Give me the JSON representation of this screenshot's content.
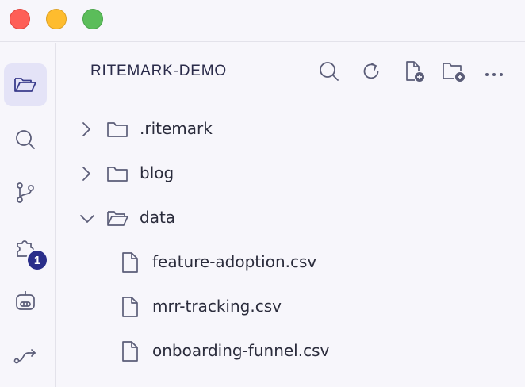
{
  "window": {
    "traffic_lights": [
      "close",
      "minimize",
      "maximize"
    ]
  },
  "activity_bar": {
    "items": [
      {
        "name": "explorer",
        "icon": "folder-open-icon",
        "active": true
      },
      {
        "name": "search",
        "icon": "search-icon",
        "active": false
      },
      {
        "name": "source-control",
        "icon": "source-control-icon",
        "active": false
      },
      {
        "name": "extensions",
        "icon": "puzzle-icon",
        "active": false,
        "badge": "1"
      },
      {
        "name": "assistant",
        "icon": "robot-icon",
        "active": false
      },
      {
        "name": "flows",
        "icon": "route-icon",
        "active": false
      }
    ]
  },
  "explorer": {
    "title": "RITEMARK-DEMO",
    "toolbar": [
      "search-icon",
      "refresh-icon",
      "new-file-icon",
      "new-folder-icon",
      "more-icon"
    ],
    "tree": [
      {
        "label": ".ritemark",
        "type": "folder",
        "expanded": false
      },
      {
        "label": "blog",
        "type": "folder",
        "expanded": false
      },
      {
        "label": "data",
        "type": "folder",
        "expanded": true
      },
      {
        "label": "feature-adoption.csv",
        "type": "file"
      },
      {
        "label": "mrr-tracking.csv",
        "type": "file"
      },
      {
        "label": "onboarding-funnel.csv",
        "type": "file"
      }
    ]
  },
  "colors": {
    "background": "#f7f6fb",
    "active_item_bg": "#e4e3f7",
    "badge": "#2a2e8a",
    "icon": "#5b5d78",
    "text": "#2b2c3c"
  }
}
